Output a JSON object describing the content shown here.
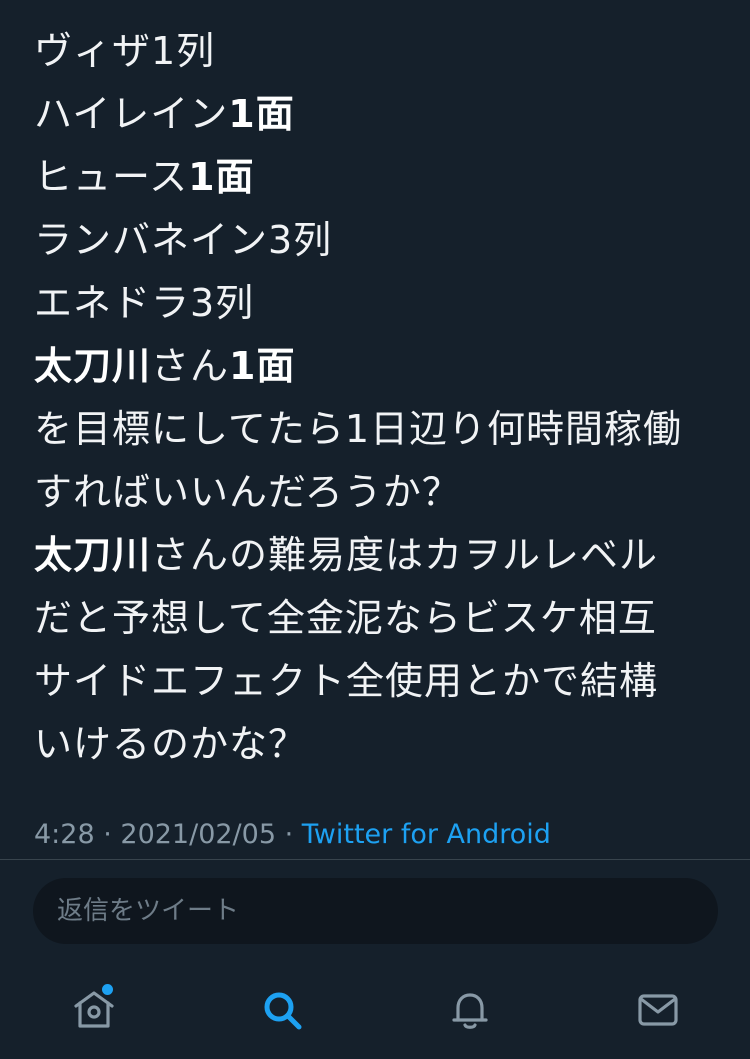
{
  "tweet": {
    "lines": [
      [
        {
          "t": "ヴィザ1列",
          "b": false
        }
      ],
      [
        {
          "t": "ハイレイン",
          "b": false
        },
        {
          "t": "1面",
          "b": true
        }
      ],
      [
        {
          "t": "ヒュース",
          "b": false
        },
        {
          "t": "1面",
          "b": true
        }
      ],
      [
        {
          "t": "ランバネイン3列",
          "b": false
        }
      ],
      [
        {
          "t": "エネドラ3列",
          "b": false
        }
      ],
      [
        {
          "t": "太刀川",
          "b": true
        },
        {
          "t": "さん",
          "b": false
        },
        {
          "t": "1面",
          "b": true
        }
      ],
      [
        {
          "t": "を目標にしてたら1日辺り何時間稼働",
          "b": false
        }
      ],
      [
        {
          "t": "すればいいんだろうか？",
          "b": false
        }
      ],
      [
        {
          "t": "太刀川",
          "b": true
        },
        {
          "t": "さんの難易度はカヲルレベル",
          "b": false
        }
      ],
      [
        {
          "t": "だと予想して全金泥ならビスケ相互",
          "b": false
        }
      ],
      [
        {
          "t": "サイドエフェクト全使用とかで結構",
          "b": false
        }
      ],
      [
        {
          "t": "いけるのかな？",
          "b": false
        }
      ]
    ],
    "time": "4:28",
    "date": "2021/02/05",
    "separator": " · ",
    "source": "Twitter for Android"
  },
  "reply": {
    "placeholder": "返信をツイート"
  },
  "tabbar": {
    "items": [
      {
        "icon": "home-icon",
        "active": false,
        "notification": true
      },
      {
        "icon": "search-icon",
        "active": true,
        "notification": false
      },
      {
        "icon": "bell-icon",
        "active": false,
        "notification": false
      },
      {
        "icon": "mail-icon",
        "active": false,
        "notification": false
      }
    ]
  },
  "colors": {
    "background": "#15202b",
    "text": "#f1f3f5",
    "muted": "#8899a6",
    "accent": "#1da1f2",
    "divider": "#38444d"
  }
}
